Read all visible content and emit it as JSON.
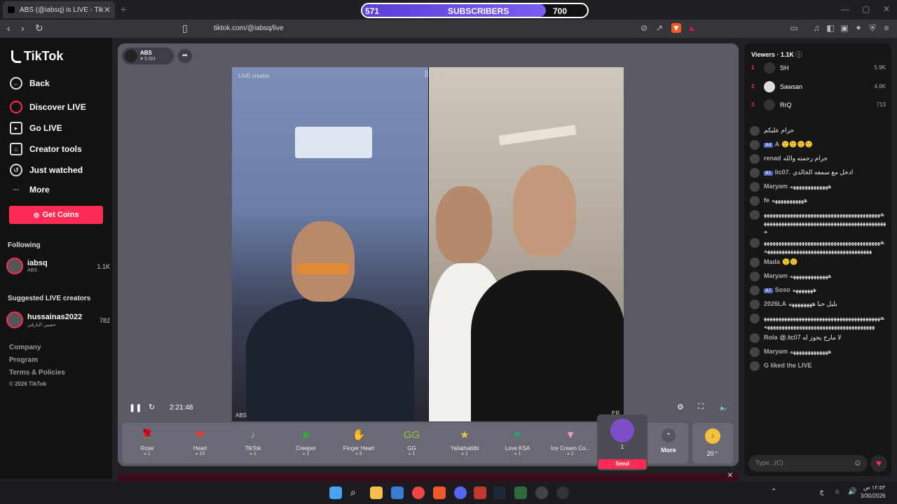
{
  "browser": {
    "tab_title": "ABS (@iabsq) is LIVE - TikTok",
    "url": "tiktok.com/@iabsq/live"
  },
  "sub_goal": {
    "current": "571",
    "label": "SUBSCRIBERS",
    "target": "700",
    "progress": 0.8157
  },
  "sidebar": {
    "logo": "TikTok",
    "nav": [
      "Back",
      "Discover LIVE",
      "Go LIVE",
      "Creator tools",
      "Just watched",
      "More"
    ],
    "get_coins": "Get Coins",
    "following_head": "Following",
    "following": {
      "name": "iabsq",
      "sub": "ABS",
      "count": "1.1K"
    },
    "suggested_head": "Suggested LIVE creators",
    "suggested": {
      "name": "hussainas2022",
      "sub": "حسين البارقي",
      "count": "782"
    },
    "footer": [
      "Company",
      "Program",
      "Terms & Policies",
      "© 2026 TikTok"
    ]
  },
  "player": {
    "streamer_name": "ABS",
    "streamer_likes": "5.6M",
    "live_creator_tag": "LIVE creator",
    "score_tag": "0",
    "left_name": "ABS",
    "right_name": "ER",
    "time": "2:21:48"
  },
  "gifts": [
    {
      "name": "Rose",
      "price": "1",
      "icon": "🌹"
    },
    {
      "name": "Heart",
      "price": "10",
      "icon": "❤"
    },
    {
      "name": "TikTok",
      "price": "1",
      "icon": "♪"
    },
    {
      "name": "Creeper",
      "price": "1",
      "icon": "■"
    },
    {
      "name": "Finger Heart",
      "price": "5",
      "icon": "✋"
    },
    {
      "name": "GG",
      "price": "1",
      "icon": "GG"
    },
    {
      "name": "Yallathabibi",
      "price": "1",
      "icon": "★"
    },
    {
      "name": "Love KSA",
      "price": "1",
      "icon": "♥"
    },
    {
      "name": "Ice Cream Co...",
      "price": "1",
      "icon": "▼"
    }
  ],
  "selected_gift": {
    "price": "1",
    "send": "Send"
  },
  "more_label": "More",
  "coins_label": "20",
  "viewers": {
    "head": "Viewers · 1.1K",
    "list": [
      {
        "rank": "1",
        "name": "SH",
        "score": "5.9K"
      },
      {
        "rank": "2",
        "name": "Sawsan",
        "score": "4.6K"
      },
      {
        "rank": "3",
        "name": "RrQ",
        "score": "713"
      }
    ]
  },
  "chat": [
    {
      "user": "",
      "badge": "",
      "text": "حرام عليكم"
    },
    {
      "user": "A",
      "badge": "A4",
      "text": "🙂🙂🙂🙂"
    },
    {
      "user": "renad",
      "badge": "",
      "text": "حرام رحمته والله"
    },
    {
      "user": "lic07.",
      "badge": "A1",
      "text": "ادخل مع سمعه الخالدي"
    },
    {
      "user": "Maryam",
      "badge": "",
      "text": "هههههههههههههه"
    },
    {
      "user": "fe",
      "badge": "",
      "text": "هههههههههههه"
    },
    {
      "user": "ه",
      "badge": "",
      "text": "ههههههههههههههههههههههههههههههههههههههههههههههههههههههههههههههههههههههههههههههههههه"
    },
    {
      "user": "ه",
      "badge": "",
      "text": "ههههههههههههههههههههههههههههههههههههههههههههههههههههههههههههههههههههههههههههه"
    },
    {
      "user": "Mada",
      "badge": "",
      "text": "🙂🙂"
    },
    {
      "user": "Maryam",
      "badge": "",
      "text": "هههههههههههههه"
    },
    {
      "user": "Soso",
      "badge": "A7",
      "text": "هههههههه"
    },
    {
      "user": "2026LA",
      "badge": "",
      "text": "بليل حبا ههههههههه"
    },
    {
      "user": "ه",
      "badge": "",
      "text": "هههههههههههههههههههههههههههههههههههههههههههههههههههههههههههههههههههههههههههههه"
    },
    {
      "user": "Rola",
      "badge": "",
      "text": "@.lic07 لا مارح يجوز له"
    },
    {
      "user": "Maryam",
      "badge": "",
      "text": "هههههههههههههه"
    },
    {
      "user": "G liked the LIVE",
      "badge": "",
      "text": ""
    }
  ],
  "chat_placeholder": "Type...(C)",
  "taskbar": {
    "time": "١٢:٥٣ ص",
    "date": "3/30/2026",
    "lang": "ع"
  },
  "colors": {
    "accent": "#fe2c55",
    "sub_fill": "#6a4ce6"
  }
}
